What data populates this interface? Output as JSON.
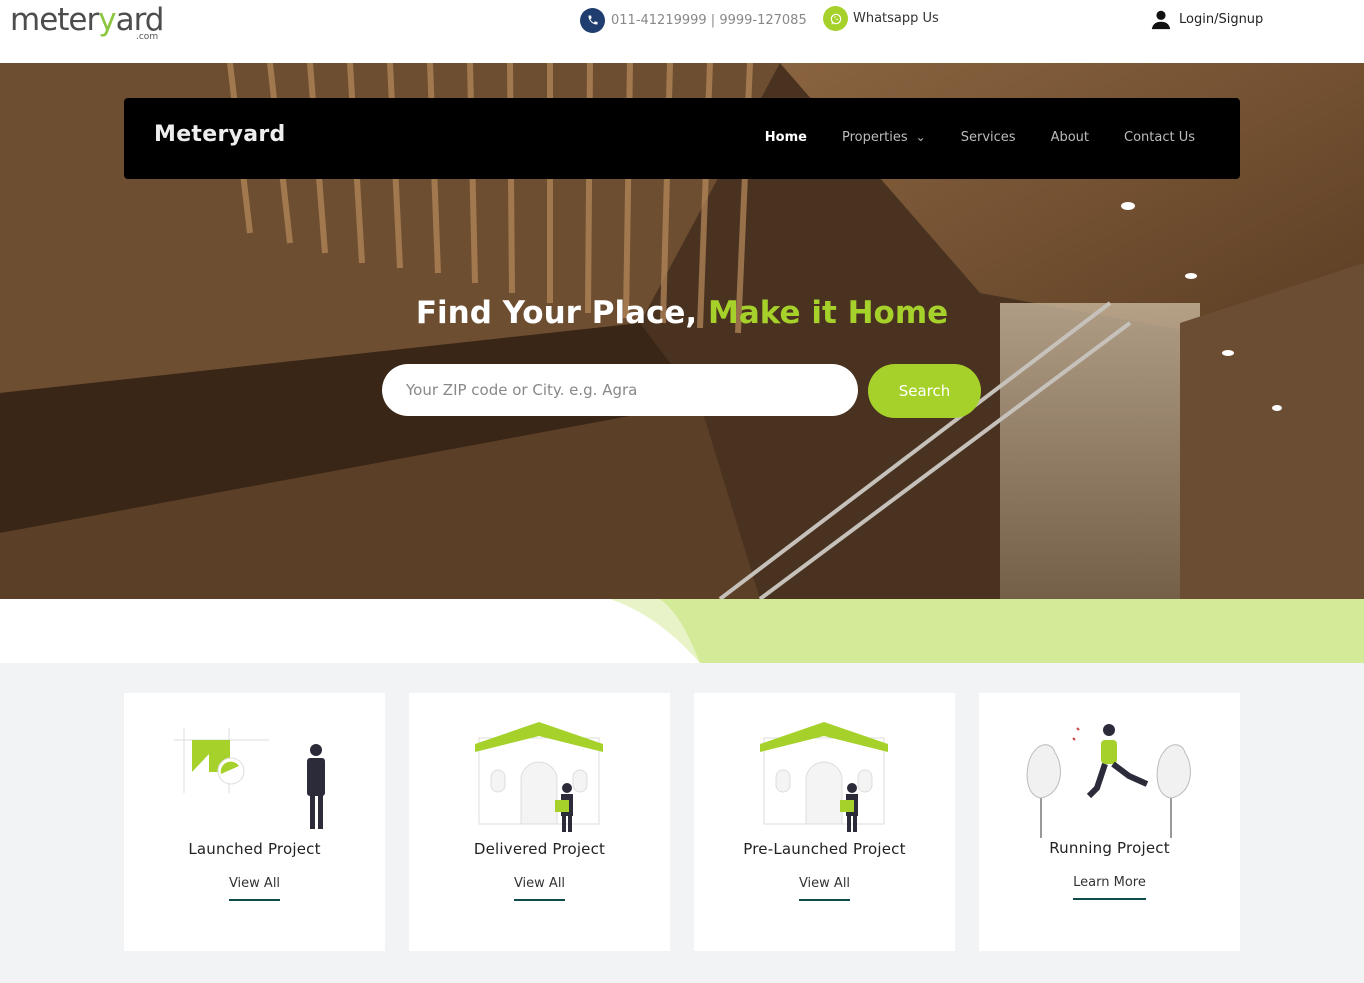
{
  "brand": {
    "logo_main": "meteryard",
    "logo_com": ".com",
    "nav_brand": "Meteryard"
  },
  "topbar": {
    "phone": "011-41219999 | 9999-127085",
    "whatsapp": "Whatsapp Us",
    "login": "Login/Signup"
  },
  "nav": {
    "items": [
      {
        "label": "Home",
        "active": true
      },
      {
        "label": "Properties",
        "dropdown": true
      },
      {
        "label": "Services"
      },
      {
        "label": "About"
      },
      {
        "label": "Contact Us"
      }
    ]
  },
  "hero": {
    "headline_part1": "Find Your Place, ",
    "headline_part2": "Make it Home",
    "search_placeholder": "Your ZIP code or City. e.g. Agra",
    "search_button": "Search"
  },
  "cards": [
    {
      "title": "Launched Project",
      "link": "View All"
    },
    {
      "title": "Delivered Project",
      "link": "View All"
    },
    {
      "title": "Pre-Launched Project",
      "link": "View All"
    },
    {
      "title": "Running Project",
      "link": "Learn More"
    }
  ],
  "colors": {
    "accent": "#a6d12b",
    "dark": "#000000",
    "link_underline": "#0f4b4b",
    "phone_icon": "#1f3d6e"
  }
}
